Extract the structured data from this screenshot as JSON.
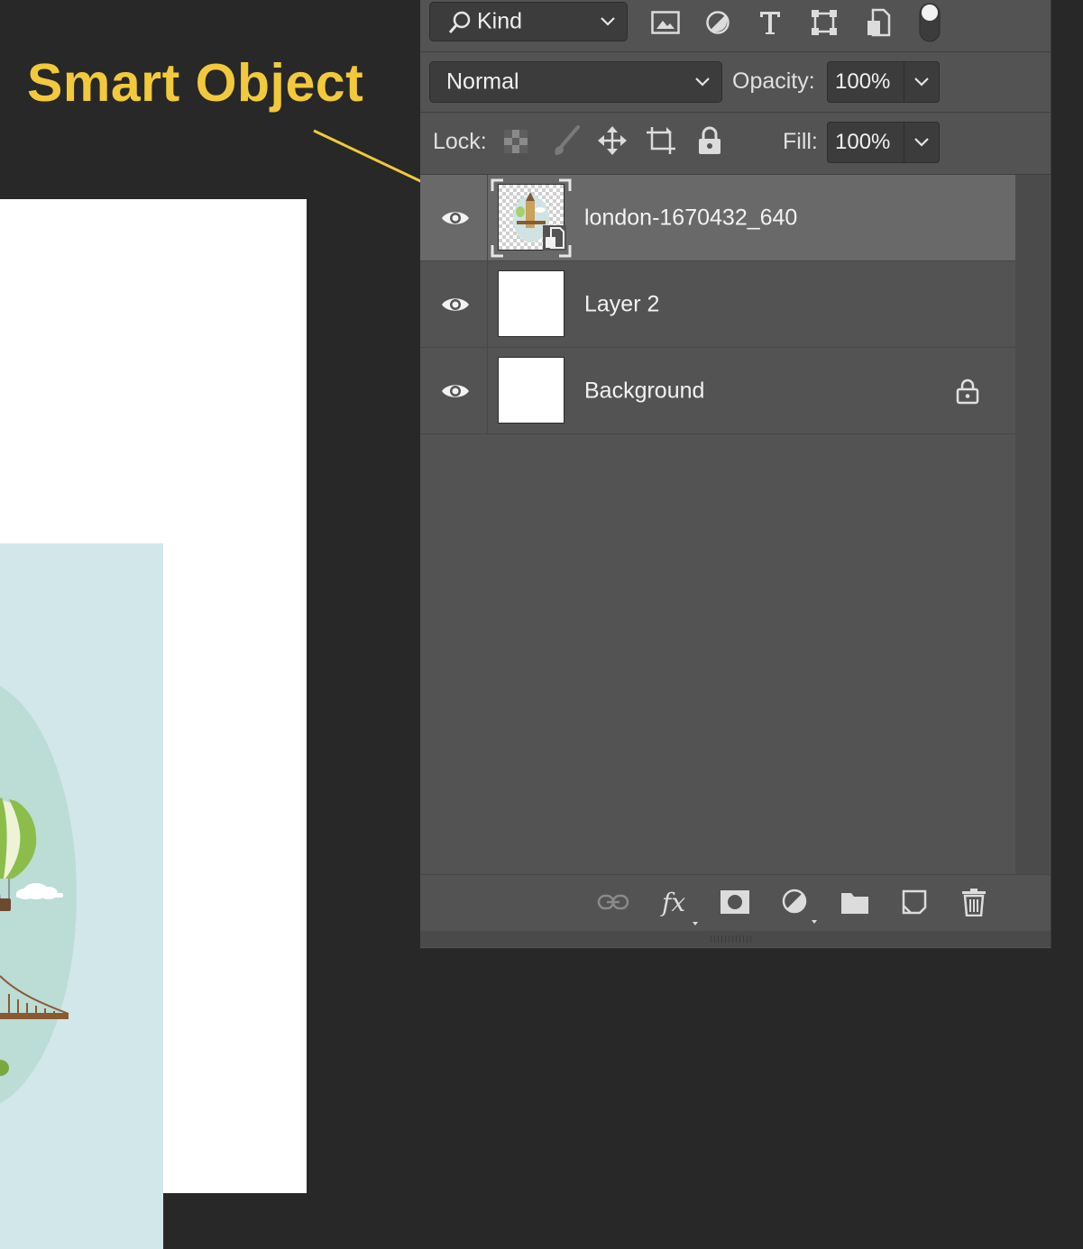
{
  "annotation": {
    "text": "Smart Object",
    "color": "#f2c93c"
  },
  "filter": {
    "kind_label": "Kind"
  },
  "blend": {
    "mode": "Normal",
    "opacity_label": "Opacity:",
    "opacity_value": "100%"
  },
  "lock": {
    "label": "Lock:",
    "fill_label": "Fill:",
    "fill_value": "100%"
  },
  "layers": [
    {
      "name": "london-1670432_640",
      "visible": true,
      "selected": true,
      "smart_object": true
    },
    {
      "name": "Layer 2",
      "visible": true,
      "selected": false
    },
    {
      "name": "Background",
      "visible": true,
      "selected": false,
      "locked": true
    }
  ],
  "footer_icons": [
    "link-icon",
    "fx-icon",
    "mask-icon",
    "adjustment-icon",
    "folder-icon",
    "new-layer-icon",
    "trash-icon"
  ],
  "colors": {
    "panel": "#535353",
    "selected_row": "#696969",
    "canvas_bg": "#282828",
    "art_bg": "#d2e7ea"
  }
}
